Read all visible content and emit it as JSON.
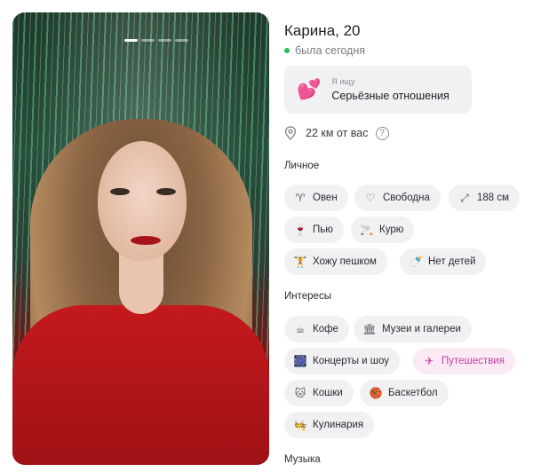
{
  "profile": {
    "name": "Карина, 20",
    "status": "была сегодня",
    "photo_count": 4,
    "active_photo": 0
  },
  "looking_for": {
    "label": "Я ищу",
    "value": "Серьёзные отношения",
    "icon": "hearts-icon"
  },
  "distance": {
    "text": "22 км от вас",
    "icon": "location-pin-icon"
  },
  "personal": {
    "title": "Личное",
    "chips": [
      {
        "label": "Овен",
        "icon": "aries-icon"
      },
      {
        "label": "Свободна",
        "icon": "heart-outline-icon"
      },
      {
        "label": "188 см",
        "icon": "height-arrows-icon"
      },
      {
        "label": "Пью",
        "icon": "glass-icon"
      },
      {
        "label": "Курю",
        "icon": "cigarette-icon"
      },
      {
        "label": "Хожу пешком",
        "icon": "dumbbell-icon"
      },
      {
        "label": "Нет детей",
        "icon": "baby-bottle-icon"
      }
    ]
  },
  "interests": {
    "title": "Интересы",
    "chips": [
      {
        "label": "Кофе",
        "icon": "coffee-icon"
      },
      {
        "label": "Музеи и галереи",
        "icon": "museum-icon"
      },
      {
        "label": "Концерты и шоу",
        "icon": "concert-icon"
      },
      {
        "label": "Путешествия",
        "icon": "airplane-icon",
        "highlighted": true
      },
      {
        "label": "Кошки",
        "icon": "cat-icon"
      },
      {
        "label": "Баскетбол",
        "icon": "basketball-icon"
      },
      {
        "label": "Кулинария",
        "icon": "cooking-icon"
      }
    ]
  },
  "music": {
    "title": "Музыка"
  },
  "colors": {
    "online": "#2cbf59",
    "chip_bg": "#f1f1f4",
    "highlight_bg": "#fbe9f4",
    "highlight_text": "#c23fa3"
  }
}
